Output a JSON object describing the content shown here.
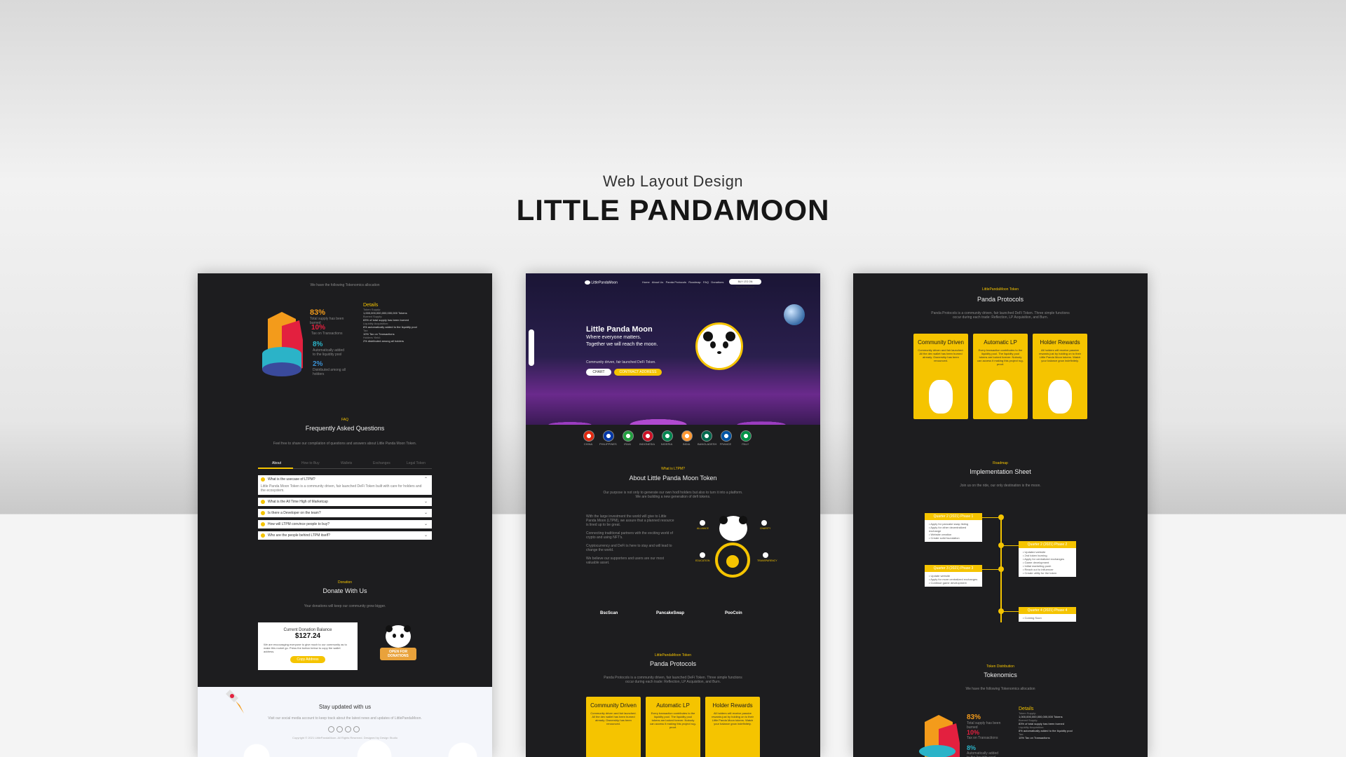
{
  "header": {
    "subtitle": "Web Layout Design",
    "title": "LITTLE PANDAMOON"
  },
  "panel_left": {
    "tokenomics": {
      "pct1": "83%",
      "pct1_label": "Total supply has been burned",
      "pct2": "10%",
      "pct2_label": "Tax on Transactions",
      "pct3": "8%",
      "pct3_label": "Automatically added to the liquidity pool",
      "pct4": "2%",
      "pct4_label": "Distributed among all holders",
      "details_title": "Details",
      "details": [
        "Token Supply:",
        "1,000,000,000,000,000,000 Tokens",
        "Burned Supply:",
        "83% of total supply has been burned",
        "Liquidity Acquisition:",
        "8% automatically added to the liquidity pool",
        "Tax:",
        "10% Tax on Transactions",
        "Holders Yield:",
        "2% distributed among all holders"
      ]
    },
    "faq": {
      "kicker": "FAQ",
      "title": "Frequently Asked Questions",
      "intro": "Feel free to share our compilation of questions and answers about Little Panda Moon Token.",
      "tabs": [
        "About",
        "How to Buy",
        "Wallets",
        "Exchanges",
        "Legal Token"
      ],
      "questions": [
        "What is the usecase of LTPM?",
        "What is the All Time High of Marketcap",
        "Is there a Developer on the team?",
        "How will LTPM convince people to buy?",
        "Who are the people behind LTPM itself?"
      ],
      "answer": "Little Panda Moon Token is a community driven, fair launched DeFi Token built with care for holders and the ecosystem."
    },
    "donate": {
      "kicker": "Donation",
      "title": "Donate With Us",
      "intro": "Your donations will keep our community grow bigger.",
      "balance_label": "Current Donation Balance",
      "balance": "$127.24",
      "text": "We are encouraging everyone to give much to our community as to make this rocket go. Press the button below to copy the wallet address.",
      "button": "Copy Address",
      "sign": "OPEN FOR DONATIONS"
    },
    "newsletter": {
      "title": "Stay updated with us",
      "text": "Visit our social media account to keep track about the latest news and updates of LittlePandaMoon.",
      "copyright": "Copyright © 2021 LittlePandaMoon. All Rights Reserved. Designed by Design Studio"
    }
  },
  "panel_middle": {
    "nav": {
      "logo": "LittlePandaMoon",
      "items": [
        "Home",
        "About Us",
        "Panda Protocols",
        "Roadmap",
        "FAQ",
        "Donations"
      ],
      "cta": "BUY LTO ON PANCAKESWAP"
    },
    "hero": {
      "title": "Little Panda Moon",
      "line1": "Where everyone matters.",
      "line2": "Together we will reach the moon.",
      "sub": "Community driven, fair launched DeFi Token.",
      "btn1": "CHART",
      "btn2": "CONTRACT ADDRESS"
    },
    "flags": [
      "CHINA",
      "PHILIPPINES",
      "IRAN",
      "INDONESIA",
      "NIGERIA",
      "INDIA",
      "BANGLADESH",
      "FRANCE",
      "ITALY"
    ],
    "about": {
      "kicker": "What is LTPM?",
      "title": "About Little Panda Moon Token",
      "intro": "Our purpose is not only to generate our own hodl holders but also to turn it into a platform. We are building a new generation of defi tokens.",
      "paras": [
        "With the large investment the world will give to Little Panda Moon (LTPM), we assure that a planned resource is lined up to be great.",
        "Connecting traditional partners with the exciting world of crypto and using NFT's.",
        "Cryptocurrency and DeFi is here to stay and will lead to change the world.",
        "We believe our supporters and users are our most valuable asset."
      ],
      "labels": [
        "ALLIANCE",
        "CHARITY",
        "EDUCATION",
        "TRANSPARENCY"
      ],
      "partners": [
        "BscScan",
        "PancakeSwap",
        "PooCoin"
      ]
    },
    "protocols": {
      "kicker": "LittlePandaMoon Token",
      "title": "Panda Protocols",
      "intro": "Panda Protocols is a community driven, fair launched DeFi Token. Three simple functions occur during each trade: Reflection, LP Acquisition, and Burn.",
      "cards": [
        {
          "title": "Community Driven",
          "text": "Community driven and fair launched. All the dev wallet has been burned already. Ownership has been renounced."
        },
        {
          "title": "Automatic LP",
          "text": "Every transaction contributes to the liquidity pool. The liquidity pool tokens are locked forever. Nobody can access it making this project rug-proof."
        },
        {
          "title": "Holder Rewards",
          "text": "All holders will receive passive rewards just by holding on to their Little Panda Moon tokens. Watch your balance grow indefinitely."
        }
      ]
    }
  },
  "panel_right": {
    "protocols": {
      "kicker": "LittlePandaMoon Token",
      "title": "Panda Protocols",
      "intro": "Panda Protocols is a community driven, fair launched DeFi Token. Three simple functions occur during each trade: Reflection, LP Acquisition, and Burn."
    },
    "roadmap": {
      "kicker": "Roadmap",
      "title": "Implementation Sheet",
      "intro": "Join us on the ride, our only destination is the moon.",
      "phases": [
        {
          "title": "Quarter 2 (2021) Phase 1",
          "items": [
            "Apply for pancake swap listing",
            "Apply for other decentralized exchange",
            "Website creation",
            "Create solid foundation"
          ]
        },
        {
          "title": "Quarter 2 (2021) Phase 2",
          "items": [
            "Updated website",
            "2nd token burning",
            "Apply for centralized exchanges",
            "Game development",
            "Initial marketing push",
            "Reach out to influencer",
            "Create utility for the token"
          ]
        },
        {
          "title": "Quarter 3 (2021) Phase 3",
          "items": [
            "Update website",
            "Apply for more centralized exchanges",
            "Continue game development"
          ]
        },
        {
          "title": "Quarter 4 (2021) Phase 4",
          "items": [
            "Coming Soon"
          ]
        }
      ]
    },
    "tokenomics": {
      "kicker": "Token Distribution",
      "title": "Tokenomics",
      "intro": "We have the following Tokenomics allocation",
      "pct1": "83%",
      "pct1_label": "Total supply has been burned",
      "pct2": "10%",
      "pct2_label": "Tax on Transactions",
      "pct3": "8%",
      "pct3_label": "Automatically added to the liquidity pool",
      "details_title": "Details",
      "details": [
        "Token Supply:",
        "1,000,000,000,000,000,000 Tokens",
        "Burned Supply:",
        "83% of total supply has been burned",
        "Liquidity Acquisition:",
        "8% automatically added to the liquidity pool",
        "Tax:",
        "10% Tax on Transactions"
      ]
    }
  }
}
